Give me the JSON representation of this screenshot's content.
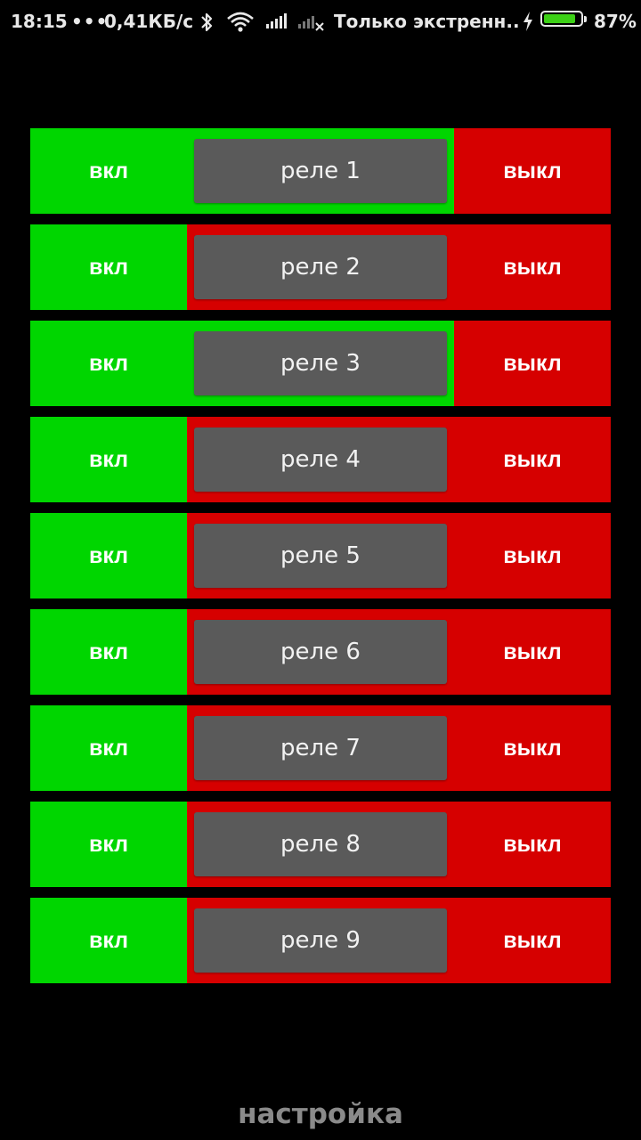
{
  "status_bar": {
    "time": "18:15",
    "dots": "•••",
    "speed": "0,41КБ/с",
    "carrier": "Только экстренн..",
    "battery_percent": "87%",
    "battery_level": 0.87,
    "icons": [
      "bluetooth-icon",
      "wifi-icon",
      "signal-icon",
      "no-signal-icon",
      "charging-icon",
      "battery-icon"
    ]
  },
  "colors": {
    "on": "#00d600",
    "off": "#d60000",
    "name_bg": "#5a5a5a",
    "background": "#000000",
    "settings_text": "#8a8a8a"
  },
  "relays": [
    {
      "name": "реле 1",
      "on_label": "вкл",
      "off_label": "выкл",
      "state": "on"
    },
    {
      "name": "реле 2",
      "on_label": "вкл",
      "off_label": "выкл",
      "state": "off"
    },
    {
      "name": "реле 3",
      "on_label": "вкл",
      "off_label": "выкл",
      "state": "on"
    },
    {
      "name": "реле 4",
      "on_label": "вкл",
      "off_label": "выкл",
      "state": "off"
    },
    {
      "name": "реле 5",
      "on_label": "вкл",
      "off_label": "выкл",
      "state": "off"
    },
    {
      "name": "реле 6",
      "on_label": "вкл",
      "off_label": "выкл",
      "state": "off"
    },
    {
      "name": "реле 7",
      "on_label": "вкл",
      "off_label": "выкл",
      "state": "off"
    },
    {
      "name": "реле 8",
      "on_label": "вкл",
      "off_label": "выкл",
      "state": "off"
    },
    {
      "name": "реле 9",
      "on_label": "вкл",
      "off_label": "выкл",
      "state": "off"
    }
  ],
  "settings": {
    "label": "настройка"
  }
}
